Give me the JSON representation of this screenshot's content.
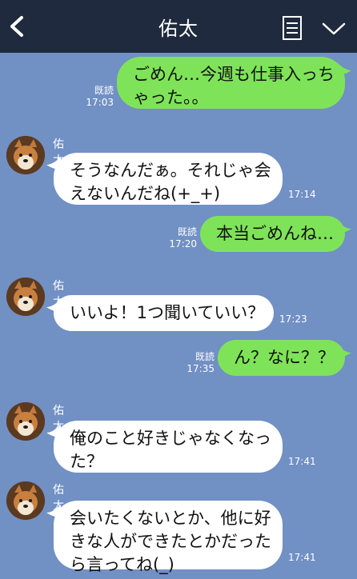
{
  "header": {
    "title": "佑太",
    "back_icon": "chevron-left-icon",
    "menu_icon": "notes-icon",
    "collapse_icon": "chevron-down-icon",
    "bg": "#1f2a3e"
  },
  "colors": {
    "background": "#7190c4",
    "outgoing_bubble": "#7fe359",
    "incoming_bubble": "#ffffff"
  },
  "messages": [
    {
      "direction": "out",
      "lines": [
        "ごめん…今週も仕事入っち",
        "ゃった。。"
      ],
      "read": "既読",
      "time": "17:03"
    },
    {
      "direction": "in",
      "sender": "佑太",
      "lines": [
        "そうなんだぁ。それじゃ会",
        "えないんだね(+_+)"
      ],
      "time": "17:14"
    },
    {
      "direction": "out",
      "lines": [
        "本当ごめんね…"
      ],
      "read": "既読",
      "time": "17:20"
    },
    {
      "direction": "in",
      "sender": "佑太",
      "lines": [
        "いいよ！1つ聞いていい？"
      ],
      "time": "17:23"
    },
    {
      "direction": "out",
      "lines": [
        "ん？なに？？"
      ],
      "read": "既読",
      "time": "17:35"
    },
    {
      "direction": "in",
      "sender": "佑太",
      "lines": [
        "俺のこと好きじゃなくなっ",
        "た？"
      ],
      "time": "17:41"
    },
    {
      "direction": "in",
      "sender": "佑太",
      "lines": [
        "会いたくないとか、他に好",
        "きな人ができたとかだった",
        "ら言ってね(_)"
      ],
      "time": "17:41"
    }
  ]
}
